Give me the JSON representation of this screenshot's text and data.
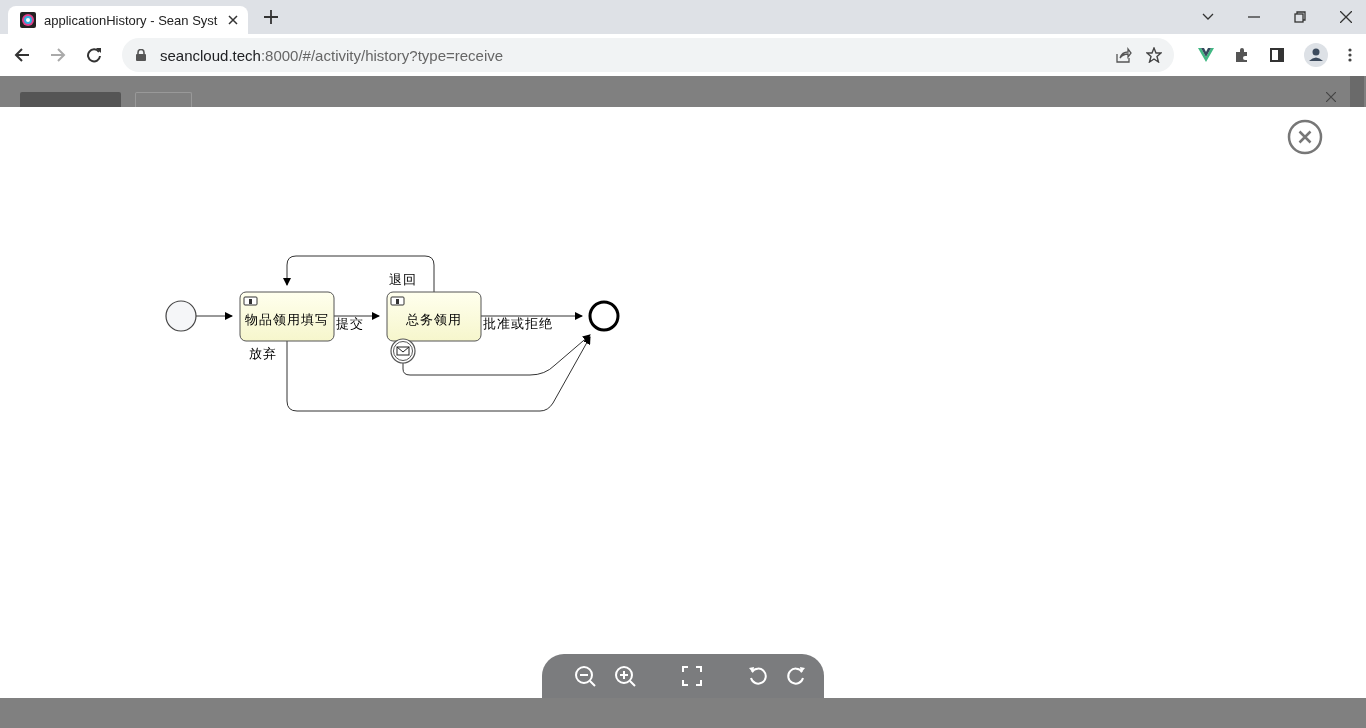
{
  "browser": {
    "tab_title": "applicationHistory - Sean Syst",
    "url_host": "seancloud.tech",
    "url_rest": ":8000/#/activity/history?type=receive"
  },
  "diagram": {
    "nodes": [
      {
        "kind": "start"
      },
      {
        "kind": "task",
        "label": "物品领用填写"
      },
      {
        "kind": "task",
        "label": "总务领用"
      },
      {
        "kind": "boundary"
      },
      {
        "kind": "end"
      }
    ],
    "flow_labels": [
      "提交",
      "批准或拒绝",
      "退回",
      "放弃"
    ]
  }
}
